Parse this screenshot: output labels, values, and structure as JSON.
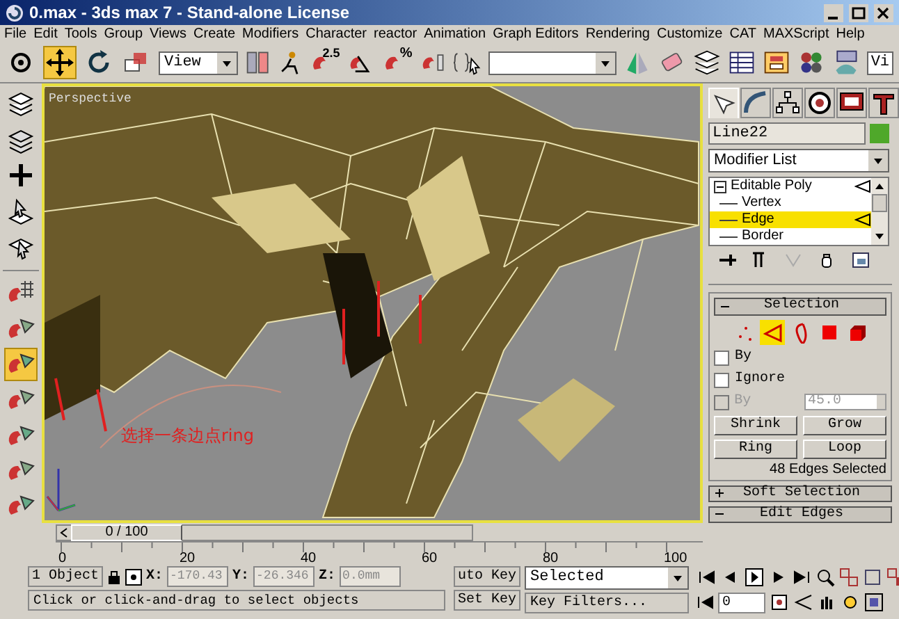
{
  "window": {
    "title": "0.max - 3ds max 7 - Stand-alone License"
  },
  "menu": [
    "File",
    "Edit",
    "Tools",
    "Group",
    "Views",
    "Create",
    "Modifiers",
    "Character",
    "reactor",
    "Animation",
    "Graph Editors",
    "Rendering",
    "Customize",
    "CAT",
    "MAXScript",
    "Help"
  ],
  "toolbar": {
    "tools": [
      {
        "selected": false
      },
      {
        "selected": true
      },
      {
        "selected": false
      },
      {
        "selected": false
      }
    ],
    "reference_coordinate": "View",
    "snap_labels": [
      "2.5",
      "%"
    ],
    "partial_view": "Vi"
  },
  "left_toolbar": [
    {
      "selected": false
    },
    {
      "selected": false
    },
    {
      "selected": false
    },
    {
      "selected": false
    },
    {
      "selected": false
    },
    {
      "selected": false
    },
    {
      "selected": false
    },
    {
      "selected": true
    },
    {
      "selected": false
    },
    {
      "selected": false
    },
    {
      "selected": false
    },
    {
      "selected": false
    }
  ],
  "viewport": {
    "label": "Perspective",
    "annotation": "选择一条边点ring",
    "time": "0 / 100",
    "level": 0
  },
  "command_panel": {
    "tabs": [
      {
        "selected": true
      },
      {
        "selected": false
      },
      {
        "selected": false
      },
      {
        "selected": false
      },
      {
        "selected": false
      },
      {
        "selected": false
      }
    ],
    "object_name": "Line22",
    "modifier_list": "Modifier List",
    "stack": [
      {
        "label": "Editable Poly",
        "expanded": true,
        "selected": false,
        "children": [
          {
            "label": "Vertex",
            "selected": false
          },
          {
            "label": "Edge",
            "selected": true
          },
          {
            "label": "Border",
            "selected": false
          }
        ]
      }
    ],
    "selection": {
      "title": "Selection",
      "expanded": true,
      "levels": [
        {
          "selected": false
        },
        {
          "selected": true
        },
        {
          "selected": false
        },
        {
          "selected": false
        },
        {
          "selected": false
        }
      ],
      "options": [
        {
          "label": "By",
          "checked": false,
          "disabled": false
        },
        {
          "label": "Ignore",
          "checked": false,
          "disabled": false
        },
        {
          "label": "By",
          "checked": false,
          "disabled": true,
          "value": "45.0"
        }
      ],
      "buttons": [
        [
          "Shrink",
          "Grow"
        ],
        [
          "Ring",
          "Loop"
        ]
      ],
      "status": "48 Edges Selected"
    },
    "rollouts": [
      {
        "title": "Soft Selection",
        "expanded": false
      },
      {
        "title": "Edit Edges",
        "expanded": true
      }
    ]
  },
  "timeline": {
    "ticks": [
      "0",
      "20",
      "40",
      "60",
      "80",
      "100"
    ]
  },
  "status": {
    "selection": "1 Object",
    "coordinates": [
      {
        "label": "X:",
        "value": "-170.43"
      },
      {
        "label": "Y:",
        "value": "-26.346"
      },
      {
        "label": "Z:",
        "value": "0.0mm"
      }
    ],
    "auto_key": "uto Key",
    "set_key": "Set Key",
    "key_mode": "Selected",
    "key_filters": "Key Filters...",
    "prompt": "Click or click-and-drag to select objects",
    "frame": "0"
  }
}
